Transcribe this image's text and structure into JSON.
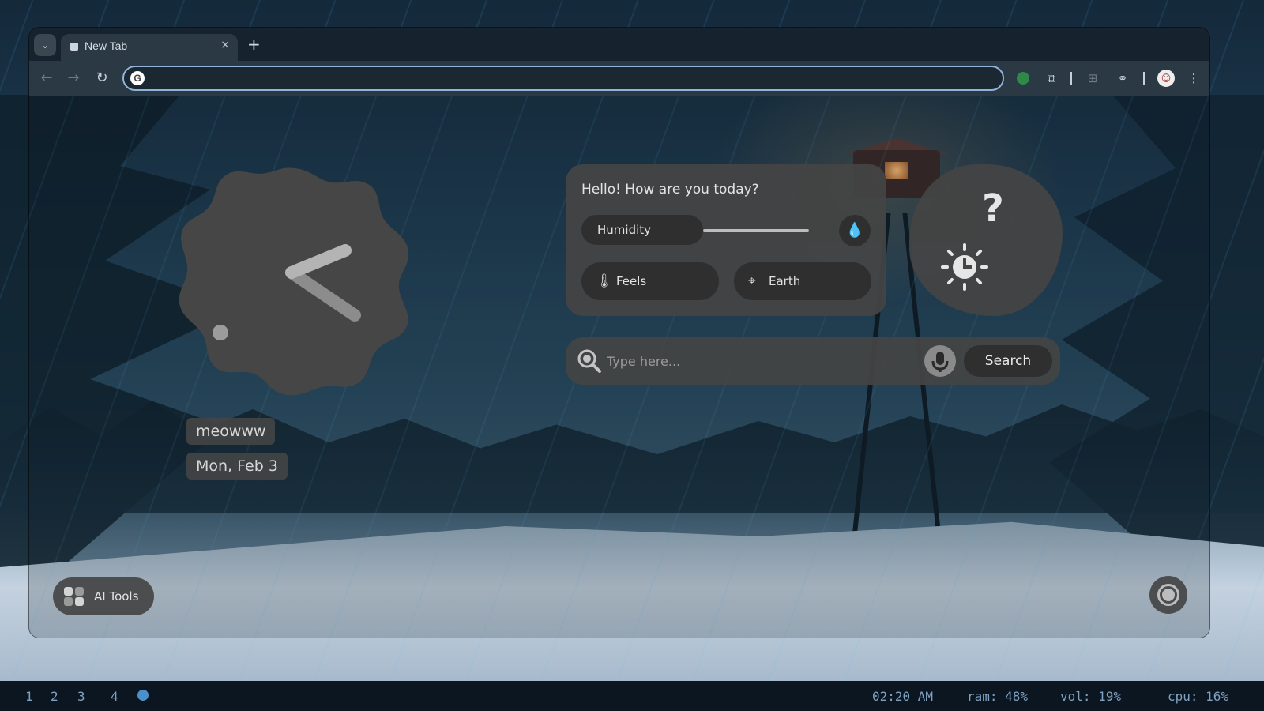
{
  "browser": {
    "tab": {
      "title": "New Tab",
      "close": "×"
    },
    "new_tab": "+",
    "omnibox": {
      "value": ""
    },
    "icons": [
      "back-icon",
      "forward-icon",
      "reload-icon",
      "google-icon",
      "extension-icon",
      "puzzle-icon",
      "translate-icon",
      "link-icon",
      "profile-icon",
      "more-menu-icon"
    ]
  },
  "page": {
    "clock": {
      "hour_angle": "hands shown",
      "style": "scalloped"
    },
    "username": "meowww",
    "date": "Mon, Feb 3",
    "greeting": "Hello! How are you today?",
    "humidity": {
      "label": "Humidity",
      "level": 0.5
    },
    "feels_label": "Feels",
    "location_label": "Earth",
    "weather_condition": "?",
    "search": {
      "placeholder": "Type here...",
      "button": "Search"
    },
    "ai_tools": "AI Tools"
  },
  "statusbar": {
    "workspaces": [
      "1",
      "2",
      "3",
      "4"
    ],
    "time": "02:20 AM",
    "ram": "ram: 48%",
    "vol": "vol: 19%",
    "cpu": "cpu: 16%"
  }
}
